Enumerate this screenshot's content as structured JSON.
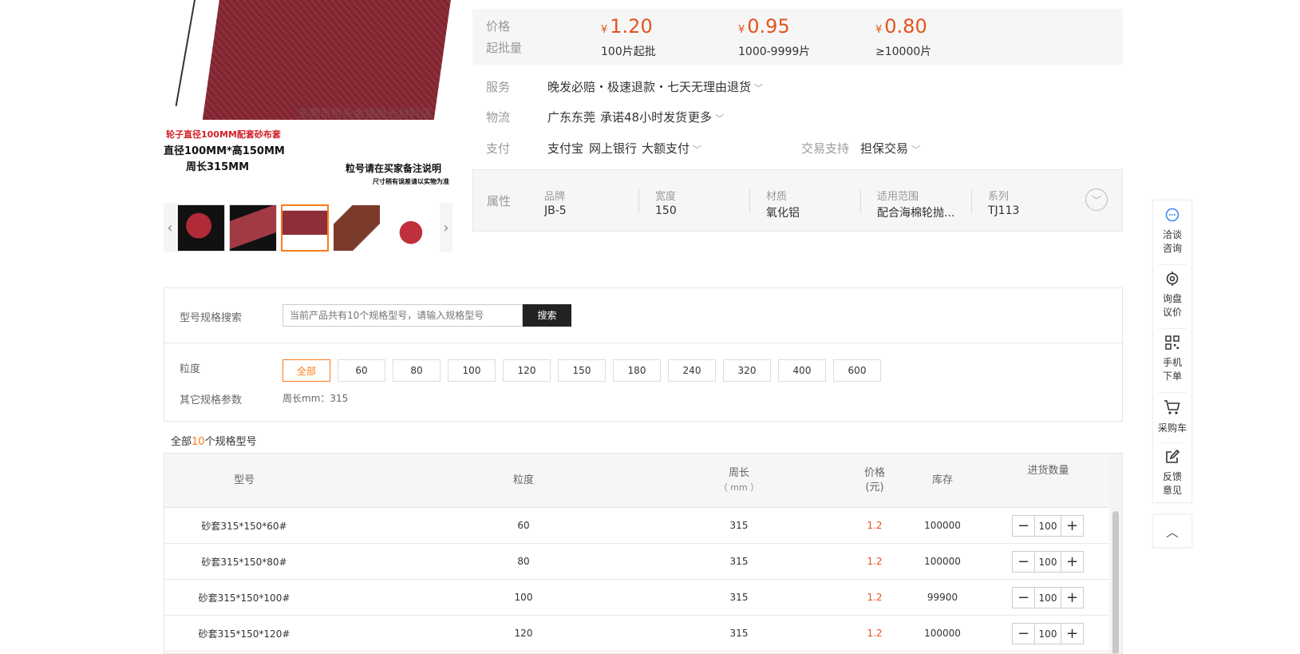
{
  "main_image": {
    "watermark": "东莞市桥头金铭抛光材料店",
    "caption_red": "轮子直径100MM配套砂布套",
    "caption_size": "直径100MM*高150MM",
    "caption_circ": "周长315MM",
    "caption_grit": "粒号请在买家备注说明",
    "caption_note": "尺寸稍有误差请以实物为准"
  },
  "thumbnails": {
    "prev_glyph": "‹",
    "next_glyph": "›",
    "count": 5,
    "active_index": 2
  },
  "price": {
    "price_label": "价格",
    "moq_label": "起批量",
    "currency": "¥",
    "tiers": [
      {
        "price": "1.20",
        "qty": "100片起批"
      },
      {
        "price": "0.95",
        "qty": "1000-9999片"
      },
      {
        "price": "0.80",
        "qty": "≥10000片"
      }
    ]
  },
  "service": {
    "label": "服务",
    "text": "晚发必赔・极速退款・七天无理由退货"
  },
  "logistics": {
    "label": "物流",
    "origin": "广东东莞",
    "promise": "承诺48小时发货",
    "more": "更多"
  },
  "payment": {
    "label": "支付",
    "methods": [
      "支付宝",
      "网上银行",
      "大额支付"
    ],
    "trade_label": "交易支持",
    "trade_value": "担保交易"
  },
  "attributes": {
    "label": "属性",
    "items": [
      {
        "k": "品牌",
        "v": "JB-5"
      },
      {
        "k": "宽度",
        "v": "150"
      },
      {
        "k": "材质",
        "v": "氧化铝"
      },
      {
        "k": "适用范围",
        "v": "配合海棉轮抛..."
      },
      {
        "k": "系列",
        "v": "TJ113"
      }
    ]
  },
  "spec_search": {
    "label": "型号规格搜索",
    "placeholder": "当前产品共有10个规格型号，请输入规格型号",
    "button": "搜索"
  },
  "grit_filter": {
    "label": "粒度",
    "options": [
      "全部",
      "60",
      "80",
      "100",
      "120",
      "150",
      "180",
      "240",
      "320",
      "400",
      "600"
    ],
    "selected": "全部",
    "other_label": "其它规格参数",
    "other_value": "周长mm：315"
  },
  "count_line": {
    "prefix": "全部",
    "count": "10",
    "suffix": "个规格型号"
  },
  "table": {
    "headers": {
      "model": "型号",
      "grit": "粒度",
      "circ": "周长",
      "circ_unit": "（ mm ）",
      "price": "价格",
      "price_unit": "(元)",
      "stock": "库存",
      "qty": "进货数量"
    },
    "rows": [
      {
        "model": "砂套315*150*60#",
        "grit": "60",
        "circ": "315",
        "price": "1.2",
        "stock": "100000",
        "qty": "100"
      },
      {
        "model": "砂套315*150*80#",
        "grit": "80",
        "circ": "315",
        "price": "1.2",
        "stock": "100000",
        "qty": "100"
      },
      {
        "model": "砂套315*150*100#",
        "grit": "100",
        "circ": "315",
        "price": "1.2",
        "stock": "99900",
        "qty": "100"
      },
      {
        "model": "砂套315*150*120#",
        "grit": "120",
        "circ": "315",
        "price": "1.2",
        "stock": "100000",
        "qty": "100"
      }
    ],
    "minus_glyph": "−",
    "plus_glyph": "+"
  },
  "sidebar": {
    "items": [
      {
        "label1": "洽谈",
        "label2": "咨询",
        "icon": "chat-icon"
      },
      {
        "label1": "询盘",
        "label2": "议价",
        "icon": "target-icon"
      },
      {
        "label1": "手机",
        "label2": "下单",
        "icon": "qrcode-icon"
      },
      {
        "label1": "采购车",
        "label2": "",
        "icon": "cart-icon"
      },
      {
        "label1": "反馈",
        "label2": "意见",
        "icon": "edit-icon"
      }
    ],
    "back_top_glyph": "︿"
  },
  "colors": {
    "accent": "#ff7a1a",
    "price": "#e4531c",
    "button_dark": "#222222",
    "link_blue": "#3d8af7"
  }
}
